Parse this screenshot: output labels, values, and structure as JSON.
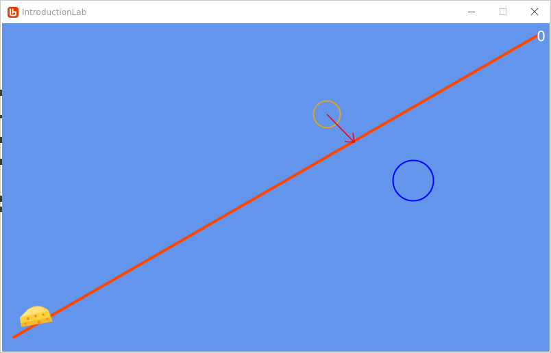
{
  "window": {
    "title": "IntroductionLab",
    "app_icon": "monogame-logo-icon",
    "controls": {
      "minimize_icon": "minimize-icon",
      "maximize_icon": "maximize-icon",
      "close_icon": "close-icon"
    }
  },
  "game": {
    "score": "0",
    "background_color": "#6495ed",
    "ramp_color": "#ff4500",
    "player_ball_color": "#daa520",
    "velocity_arrow_color": "#ff0000",
    "target_circle_color": "#0000ff",
    "cheese_icon": "cheese-icon"
  }
}
